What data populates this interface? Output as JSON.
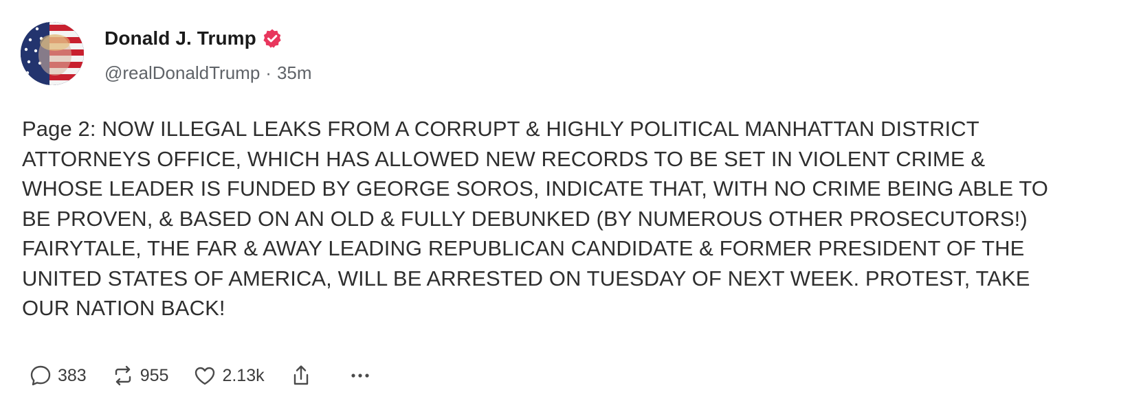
{
  "author": {
    "display_name": "Donald J. Trump",
    "handle": "@realDonaldTrump",
    "separator": "·",
    "time_ago": "35m",
    "avatar_icon": "flag-portrait-avatar",
    "verified_icon": "verified-badge-icon",
    "verified_color": "#e8365d"
  },
  "post": {
    "text": "Page 2: NOW ILLEGAL LEAKS FROM A CORRUPT & HIGHLY POLITICAL MANHATTAN DISTRICT\nATTORNEYS OFFICE, WHICH HAS ALLOWED NEW RECORDS TO BE SET IN VIOLENT CRIME &\nWHOSE LEADER IS FUNDED BY GEORGE SOROS, INDICATE THAT, WITH NO CRIME BEING ABLE TO\nBE PROVEN, & BASED ON AN OLD & FULLY DEBUNKED (BY NUMEROUS OTHER PROSECUTORS!)\nFAIRYTALE, THE FAR & AWAY LEADING REPUBLICAN CANDIDATE & FORMER PRESIDENT OF THE\nUNITED STATES OF AMERICA, WILL BE ARRESTED ON TUESDAY OF NEXT WEEK. PROTEST, TAKE\nOUR NATION BACK!"
  },
  "actions": {
    "replies": {
      "icon": "reply-icon",
      "count": "383"
    },
    "retruths": {
      "icon": "retruth-icon",
      "count": "955"
    },
    "likes": {
      "icon": "heart-icon",
      "count": "2.13k"
    },
    "share": {
      "icon": "share-icon"
    },
    "more": {
      "icon": "more-icon"
    }
  }
}
